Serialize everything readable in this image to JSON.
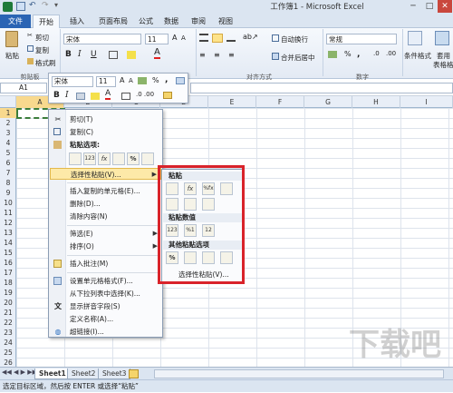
{
  "window": {
    "title": "工作簿1 - Microsoft Excel"
  },
  "tabs": [
    {
      "label": "文件"
    },
    {
      "label": "开始"
    },
    {
      "label": "插入"
    },
    {
      "label": "页面布局"
    },
    {
      "label": "公式"
    },
    {
      "label": "数据"
    },
    {
      "label": "审阅"
    },
    {
      "label": "视图"
    }
  ],
  "ribbon": {
    "paste": "粘贴",
    "cut": "剪切",
    "copy": "复制",
    "format_painter": "格式刷",
    "clipboard_group": "剪贴板",
    "font_name": "宋体",
    "font_size": "11",
    "bold": "B",
    "italic": "I",
    "underline": "U",
    "wrap_text": "自动换行",
    "merge_center": "合并后居中",
    "alignment_group": "对齐方式",
    "number_format": "常规",
    "percent": "%",
    "comma": ",",
    "number_group": "数字",
    "cond_format": "条件格式",
    "cond_format2": "套用",
    "table_format": "表格格式"
  },
  "formula_bar": {
    "name_box": "A1"
  },
  "columns": [
    "A",
    "B",
    "C",
    "D",
    "E",
    "F",
    "G",
    "H",
    "I"
  ],
  "rows": [
    "1",
    "2",
    "3",
    "4",
    "5",
    "6",
    "7",
    "8",
    "9",
    "10",
    "11",
    "12",
    "13",
    "14",
    "15",
    "16",
    "17",
    "18",
    "19",
    "20",
    "21",
    "22",
    "23",
    "24",
    "25",
    "26"
  ],
  "mini_toolbar": {
    "font": "宋体",
    "size": "11",
    "bold": "B",
    "italic": "I",
    "percent": "%",
    "comma": ","
  },
  "context_menu": {
    "items": [
      {
        "label": "剪切(T)"
      },
      {
        "label": "复制(C)"
      },
      {
        "label": "粘贴选项:"
      },
      {
        "label": "选择性粘贴(V)..."
      },
      {
        "label": "插入复制的单元格(E)..."
      },
      {
        "label": "删除(D)..."
      },
      {
        "label": "清除内容(N)"
      },
      {
        "label": "筛选(E)"
      },
      {
        "label": "排序(O)"
      },
      {
        "label": "插入批注(M)"
      },
      {
        "label": "设置单元格格式(F)..."
      },
      {
        "label": "从下拉列表中选择(K)..."
      },
      {
        "label": "显示拼音字段(S)"
      },
      {
        "label": "定义名称(A)..."
      },
      {
        "label": "超链接(I)..."
      }
    ],
    "paste_icons": [
      "123",
      "fx",
      "%"
    ]
  },
  "submenu": {
    "paste_header": "粘贴",
    "paste_values_header": "粘贴数值",
    "other_header": "其他粘贴选项",
    "paste_special": "选择性粘贴(V)...",
    "icon_labels": [
      "fx",
      "123",
      "%"
    ]
  },
  "sheets": [
    "Sheet1",
    "Sheet2",
    "Sheet3"
  ],
  "status": "选定目标区域，然后按 ENTER 或选择“粘贴”",
  "watermark": "下载吧",
  "colors": {
    "file_tab": "#2a64b4",
    "highlight": "#fde9a8",
    "redbox": "#d9232a"
  }
}
